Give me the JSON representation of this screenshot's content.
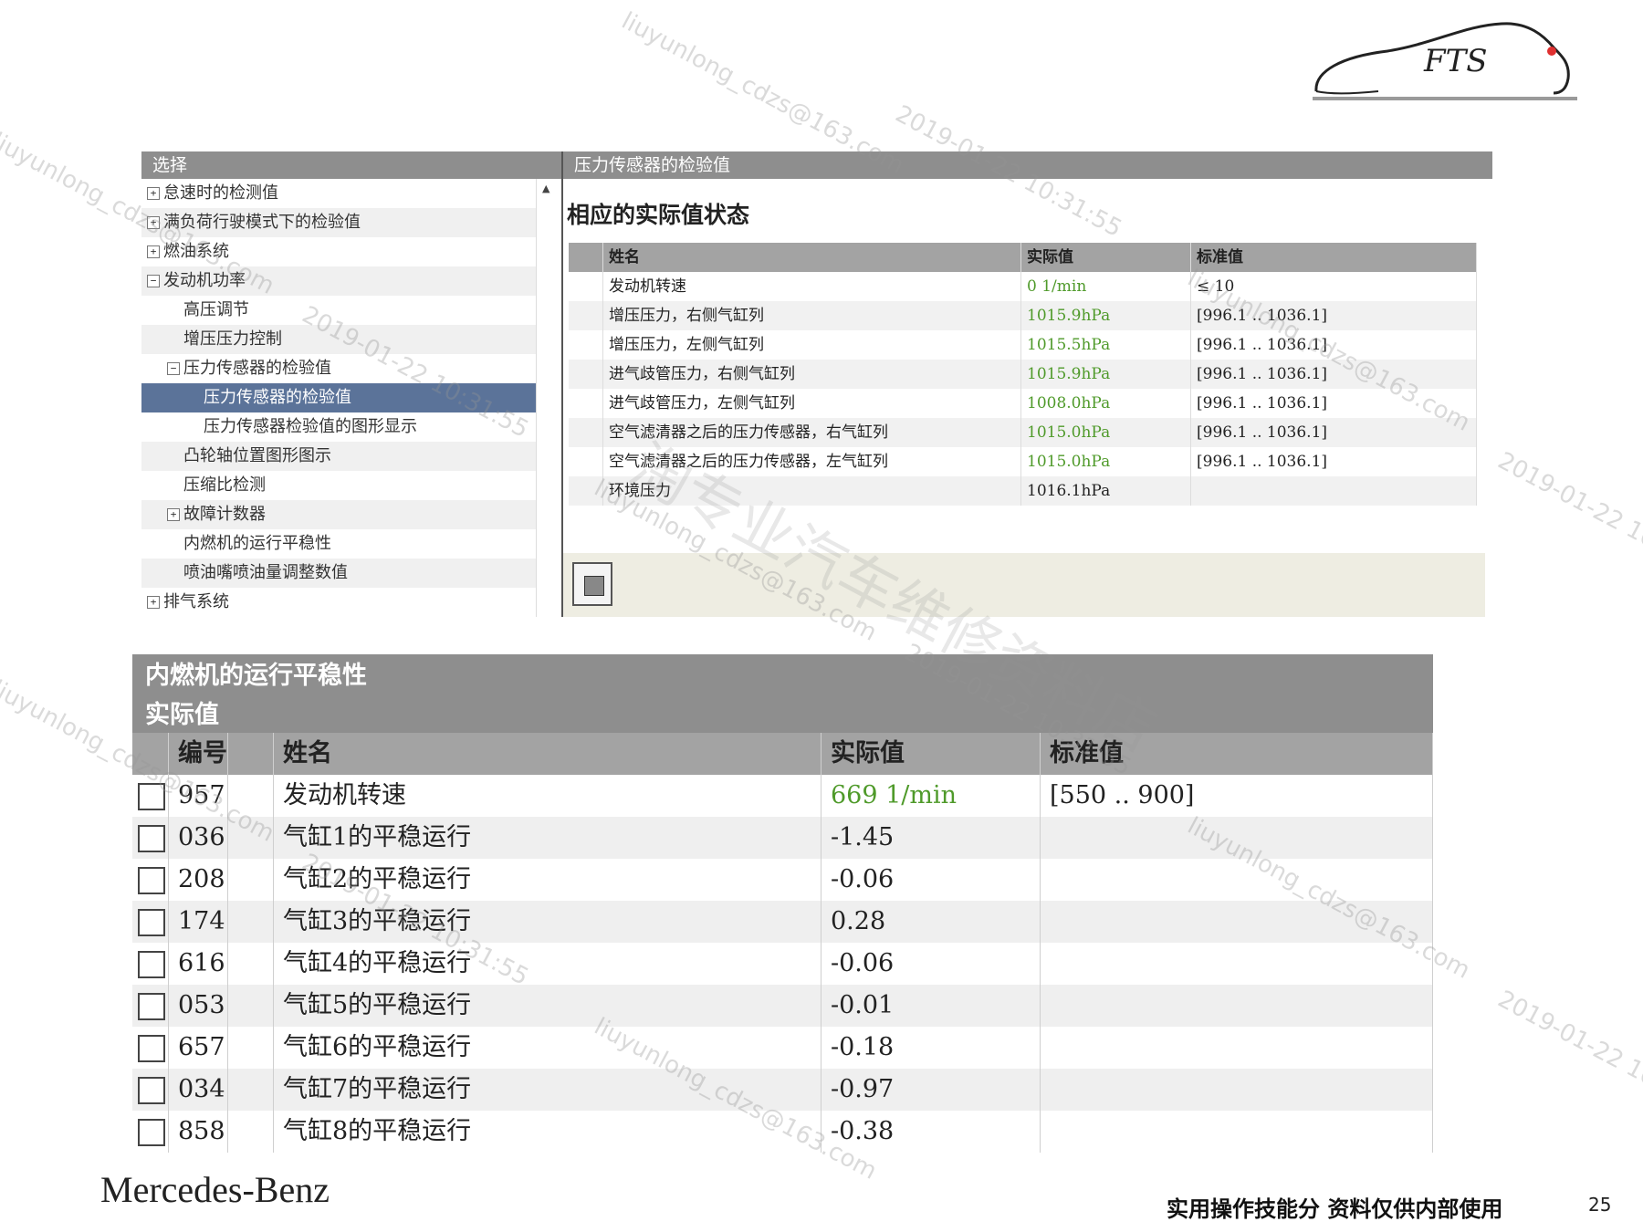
{
  "logo": {
    "text": "FTS",
    "accent": "#e03030"
  },
  "top_panel": {
    "tree_header": "选择",
    "tree_items": [
      {
        "label": "怠速时的检测值",
        "expander": "+",
        "indent": 0
      },
      {
        "label": "满负荷行驶模式下的检验值",
        "expander": "+",
        "indent": 0
      },
      {
        "label": "燃油系统",
        "expander": "+",
        "indent": 0
      },
      {
        "label": "发动机功率",
        "expander": "−",
        "indent": 0
      },
      {
        "label": "高压调节",
        "expander": "",
        "indent": 1
      },
      {
        "label": "增压压力控制",
        "expander": "",
        "indent": 1
      },
      {
        "label": "压力传感器的检验值",
        "expander": "−",
        "indent": 1
      },
      {
        "label": "压力传感器的检验值",
        "expander": "",
        "indent": 2,
        "selected": true
      },
      {
        "label": "压力传感器检验值的图形显示",
        "expander": "",
        "indent": 2
      },
      {
        "label": "凸轮轴位置图形图示",
        "expander": "",
        "indent": 1
      },
      {
        "label": "压缩比检测",
        "expander": "",
        "indent": 1
      },
      {
        "label": "故障计数器",
        "expander": "+",
        "indent": 1
      },
      {
        "label": "内燃机的运行平稳性",
        "expander": "",
        "indent": 1
      },
      {
        "label": "喷油嘴喷油量调整数值",
        "expander": "",
        "indent": 1
      },
      {
        "label": "排气系统",
        "expander": "+",
        "indent": 0
      }
    ],
    "right_header": "压力传感器的检验值",
    "section_title": "相应的实际值状态",
    "columns": [
      "姓名",
      "实际值",
      "标准值"
    ],
    "rows": [
      {
        "name": "发动机转速",
        "actual": "0 1/min",
        "standard": "≤ 10"
      },
      {
        "name": "增压压力，右侧气缸列",
        "actual": "1015.9hPa",
        "standard": "[996.1 .. 1036.1]"
      },
      {
        "name": "增压压力，左侧气缸列",
        "actual": "1015.5hPa",
        "standard": "[996.1 .. 1036.1]"
      },
      {
        "name": "进气歧管压力，右侧气缸列",
        "actual": "1015.9hPa",
        "standard": "[996.1 .. 1036.1]"
      },
      {
        "name": "进气歧管压力，左侧气缸列",
        "actual": "1008.0hPa",
        "standard": "[996.1 .. 1036.1]"
      },
      {
        "name": "空气滤清器之后的压力传感器，右气缸列",
        "actual": "1015.0hPa",
        "standard": "[996.1 .. 1036.1]"
      },
      {
        "name": "空气滤清器之后的压力传感器，左气缸列",
        "actual": "1015.0hPa",
        "standard": "[996.1 .. 1036.1]"
      },
      {
        "name": "环境压力",
        "actual": "1016.1hPa",
        "standard": ""
      }
    ]
  },
  "bottom_panel": {
    "title": "内燃机的运行平稳性",
    "subtitle": "实际值",
    "columns": [
      "编号",
      "姓名",
      "实际值",
      "标准值"
    ],
    "rows": [
      {
        "id": "957",
        "name": "发动机转速",
        "actual": "669 1/min",
        "standard": "[550 .. 900]"
      },
      {
        "id": "036",
        "name": "气缸1的平稳运行",
        "actual": "-1.45",
        "standard": ""
      },
      {
        "id": "208",
        "name": "气缸2的平稳运行",
        "actual": "-0.06",
        "standard": ""
      },
      {
        "id": "174",
        "name": "气缸3的平稳运行",
        "actual": "0.28",
        "standard": ""
      },
      {
        "id": "616",
        "name": "气缸4的平稳运行",
        "actual": "-0.06",
        "standard": ""
      },
      {
        "id": "053",
        "name": "气缸5的平稳运行",
        "actual": "-0.01",
        "standard": ""
      },
      {
        "id": "657",
        "name": "气缸6的平稳运行",
        "actual": "-0.18",
        "standard": ""
      },
      {
        "id": "034",
        "name": "气缸7的平稳运行",
        "actual": "-0.97",
        "standard": ""
      },
      {
        "id": "858",
        "name": "气缸8的平稳运行",
        "actual": "-0.38",
        "standard": ""
      }
    ]
  },
  "footer": {
    "brand": "Mercedes-Benz",
    "note": "实用操作技能分 资料仅供内部使用",
    "page": "25"
  },
  "watermarks": {
    "email": "liuyunlong_cdzs@163.com",
    "timestamp": "2019-01-22 10:31:55",
    "shop": "淘专业汽车维修资料店"
  },
  "colors": {
    "header_gray": "#8e8e8e",
    "selected_blue": "#5b7399",
    "value_green": "#4f9a2a"
  }
}
